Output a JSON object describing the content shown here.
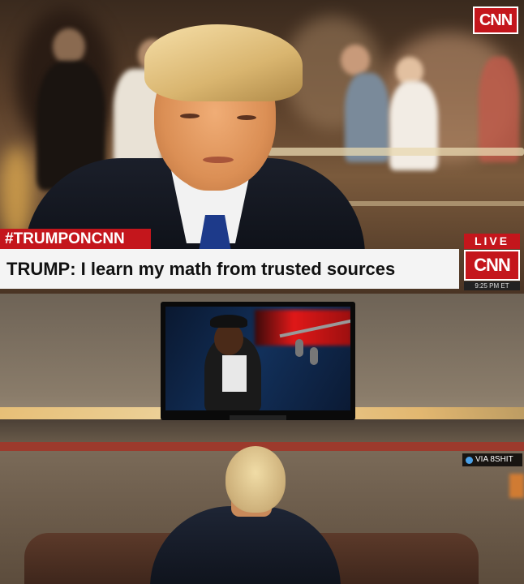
{
  "top_panel": {
    "channel_logo": "CNN",
    "hashtag": "#TRUMPONCNN",
    "headline": "TRUMP: I learn my math from trusted sources",
    "live_label": "LIVE",
    "ticker_logo": "CNN",
    "time": "9:25 PM ET",
    "colors": {
      "brand_red": "#c4161c",
      "ticker_bg": "#f4f4f4"
    }
  },
  "bottom_panel": {
    "credit": "VIA 8SHIT",
    "credit_icon": "link-icon"
  }
}
